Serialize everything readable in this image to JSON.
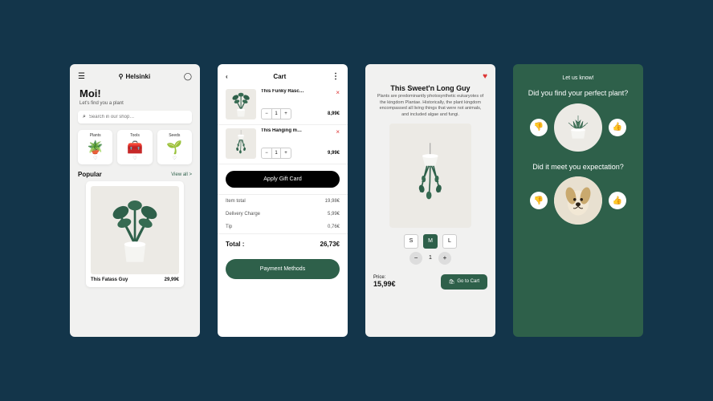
{
  "home": {
    "location": "Helsinki",
    "greeting": "Moi!",
    "subtitle": "Let's find you a plant",
    "search_placeholder": "Search in our shop…",
    "cats": [
      "Plants",
      "Tools",
      "Seeds"
    ],
    "popular_label": "Popular",
    "view_all": "View all >",
    "card_name": "This Fatass Guy",
    "card_price": "29,99€"
  },
  "cart": {
    "title": "Cart",
    "items": [
      {
        "name": "This Funky Rasc…",
        "qty": 1,
        "price": "8,99€"
      },
      {
        "name": "This Hanging m…",
        "qty": 1,
        "price": "9,99€"
      }
    ],
    "gift_label": "Apply Gift Card",
    "rows": [
      {
        "label": "Item total",
        "value": "19,98€"
      },
      {
        "label": "Delivery Charge",
        "value": "5,99€"
      },
      {
        "label": "Tip",
        "value": "0,76€"
      }
    ],
    "total_label": "Total :",
    "total_value": "26,73€",
    "pay_label": "Payment Methods"
  },
  "product": {
    "title": "This Sweet'n Long Guy",
    "desc": "Plants are predominantly photosynthetic eukaryotes of the kingdom Plantae. Historically, the plant kingdom encompassed all living things that were not animals, and included algae and fungi.",
    "sizes": [
      "S",
      "M",
      "L"
    ],
    "qty": 1,
    "price_label": "Price:",
    "price": "15,99€",
    "cart_label": "Go to Cart"
  },
  "feedback": {
    "header": "Let us know!",
    "q1": "Did you find your perfect plant?",
    "q2": "Did it meet you expectation?"
  }
}
